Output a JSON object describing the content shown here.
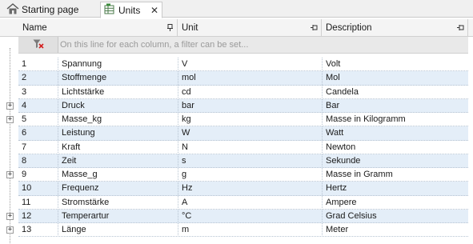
{
  "tabs": [
    {
      "label": "Starting page",
      "icon": "home-icon"
    },
    {
      "label": "Units",
      "icon": "table-icon",
      "close": "✕"
    }
  ],
  "columns": {
    "name": "Name",
    "unit": "Unit",
    "description": "Description"
  },
  "filter": {
    "placeholder": "On this line for each column, a filter can be set..."
  },
  "rows": [
    {
      "num": "1",
      "name": "Spannung",
      "unit": "V",
      "description": "Volt",
      "expandable": false
    },
    {
      "num": "2",
      "name": "Stoffmenge",
      "unit": "mol",
      "description": "Mol",
      "expandable": false
    },
    {
      "num": "3",
      "name": "Lichtstärke",
      "unit": "cd",
      "description": "Candela",
      "expandable": false
    },
    {
      "num": "4",
      "name": "Druck",
      "unit": "bar",
      "description": "Bar",
      "expandable": true
    },
    {
      "num": "5",
      "name": "Masse_kg",
      "unit": "kg",
      "description": "Masse in Kilogramm",
      "expandable": true
    },
    {
      "num": "6",
      "name": "Leistung",
      "unit": "W",
      "description": "Watt",
      "expandable": false
    },
    {
      "num": "7",
      "name": "Kraft",
      "unit": "N",
      "description": "Newton",
      "expandable": false
    },
    {
      "num": "8",
      "name": "Zeit",
      "unit": "s",
      "description": "Sekunde",
      "expandable": false
    },
    {
      "num": "9",
      "name": "Masse_g",
      "unit": "g",
      "description": "Masse in Gramm",
      "expandable": true
    },
    {
      "num": "10",
      "name": "Frequenz",
      "unit": "Hz",
      "description": "Hertz",
      "expandable": false
    },
    {
      "num": "11",
      "name": "Stromstärke",
      "unit": "A",
      "description": "Ampere",
      "expandable": false
    },
    {
      "num": "12",
      "name": "Temperartur",
      "unit": "°C",
      "description": "Grad Celsius",
      "expandable": true
    },
    {
      "num": "13",
      "name": "Länge",
      "unit": "m",
      "description": "Meter",
      "expandable": true
    }
  ]
}
